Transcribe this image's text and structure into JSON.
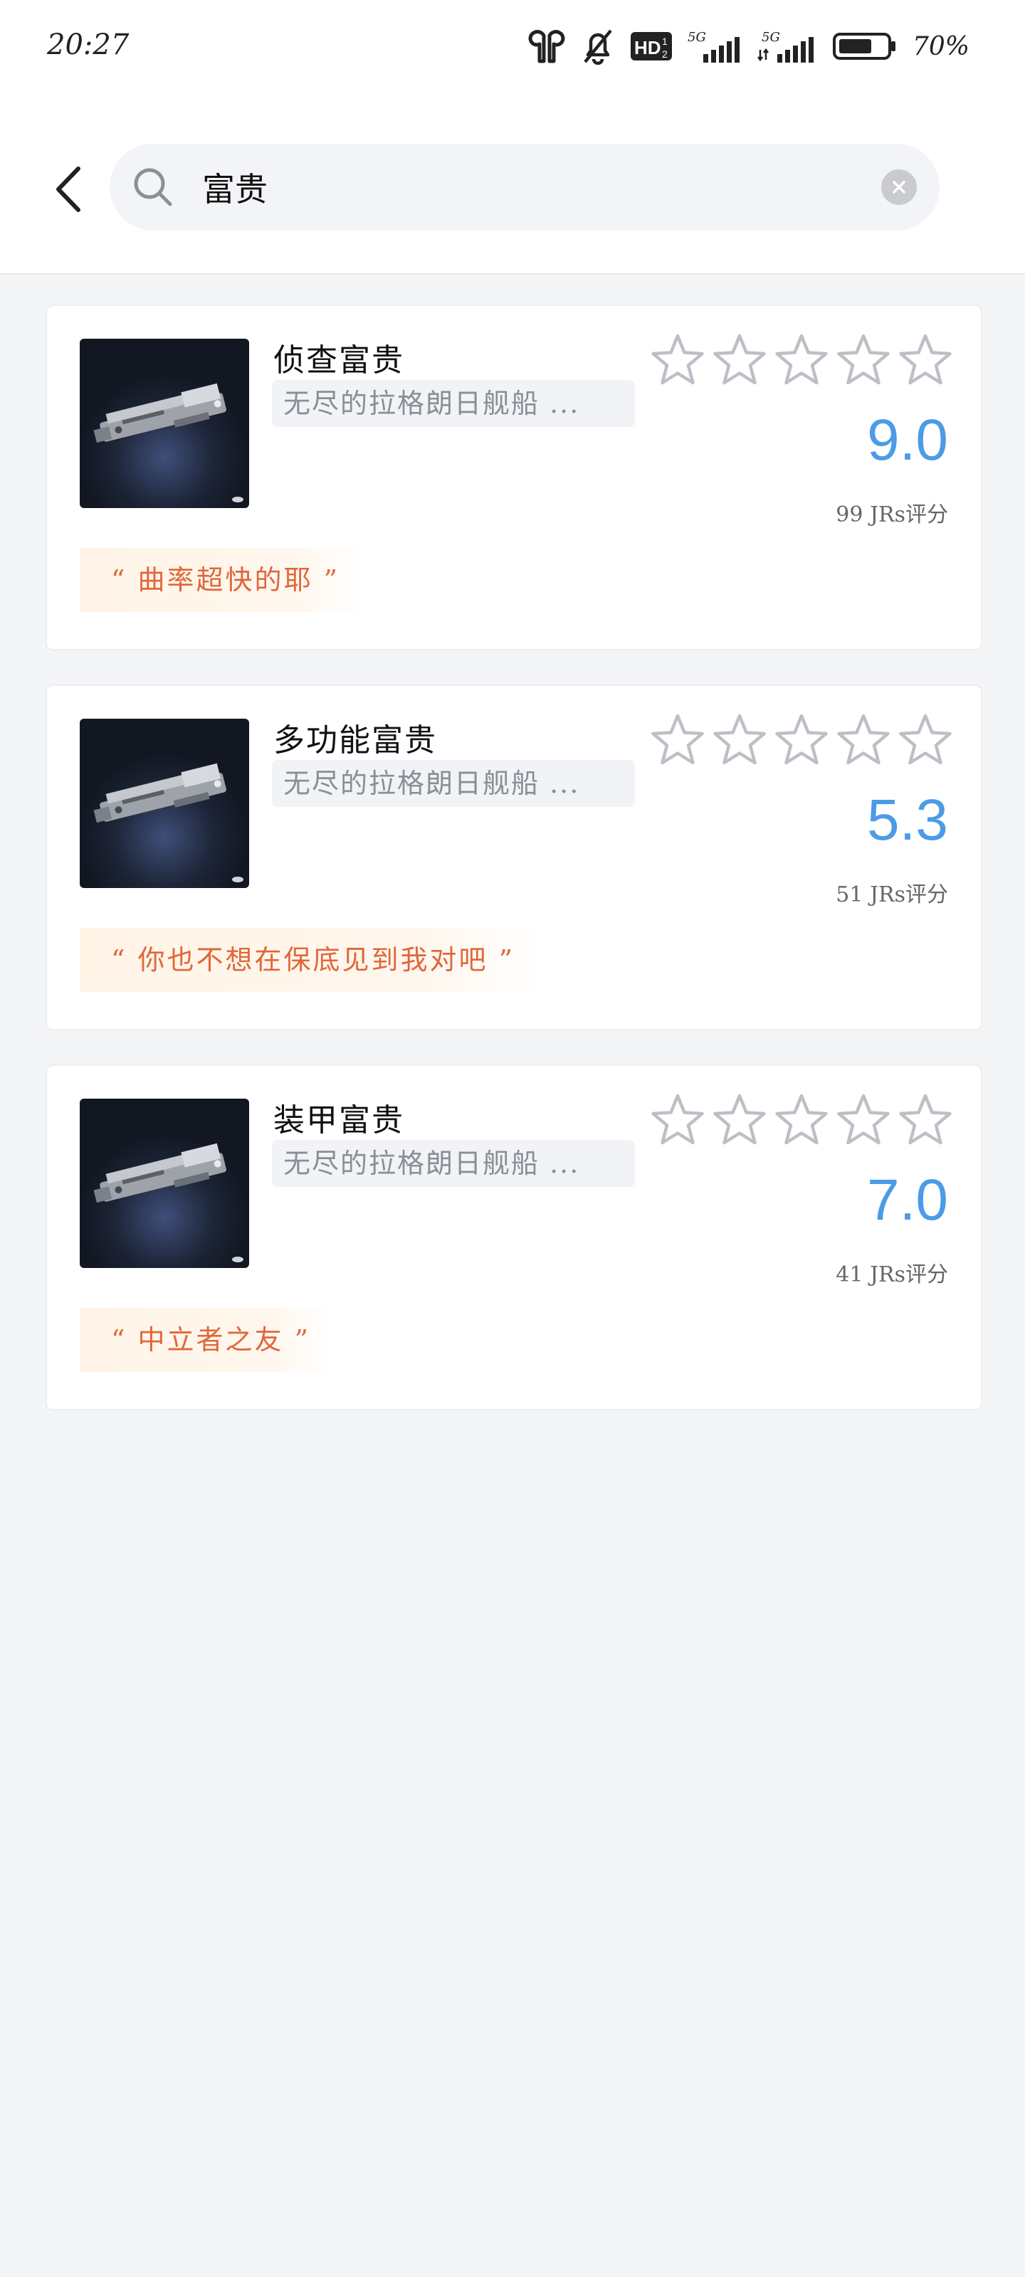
{
  "status_bar": {
    "time": "20:27",
    "icons": [
      "earbuds-icon",
      "bell-muted-icon",
      "hd-icon",
      "signal-5g-icon",
      "signal-5g-icon",
      "battery-icon"
    ],
    "battery_text": "70%",
    "battery_level": 0.7
  },
  "header": {
    "search_value": "富贵",
    "back_icon": "chevron-left-icon",
    "search_icon": "search-icon",
    "clear_icon": "clear-icon"
  },
  "results": [
    {
      "title": "侦查富贵",
      "tag": "无尽的拉格朗日舰船 ...",
      "stars_filled": 0,
      "stars_total": 5,
      "score": "9.0",
      "rating_count": "99 JRs评分",
      "quote": "“ 曲率超快的耶 ”"
    },
    {
      "title": "多功能富贵",
      "tag": "无尽的拉格朗日舰船 ...",
      "stars_filled": 0,
      "stars_total": 5,
      "score": "5.3",
      "rating_count": "51 JRs评分",
      "quote": "“ 你也不想在保底见到我对吧 ”"
    },
    {
      "title": "装甲富贵",
      "tag": "无尽的拉格朗日舰船 ...",
      "stars_filled": 0,
      "stars_total": 5,
      "score": "7.0",
      "rating_count": "41 JRs评分",
      "quote": "“ 中立者之友 ”"
    }
  ],
  "colors": {
    "score": "#4c9be6",
    "quote_text": "#e0673a",
    "quote_bg": "#fff4e6",
    "page_bg": "#f4f5f7"
  }
}
